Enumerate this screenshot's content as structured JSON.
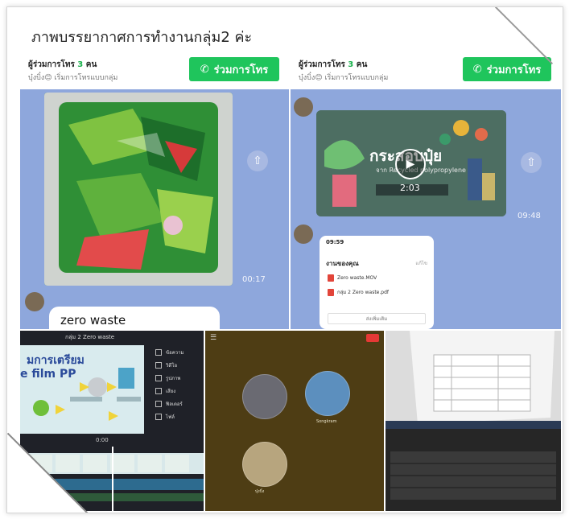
{
  "title": "ภาพบรรยากาศการทำงานกลุ่ม2 ค่ะ",
  "call_left": {
    "count_prefix": "ผู้ร่วมการโทร",
    "count_number": "3",
    "count_suffix": "คน",
    "subtitle": "บุ๋งบิ๋ง😊 เริ่มการโทรแบบกลุ่ม",
    "join_label": "ร่วมการโทร",
    "photo_time": "00:17",
    "message": "zero waste"
  },
  "call_right": {
    "count_prefix": "ผู้ร่วมการโทร",
    "count_number": "3",
    "count_suffix": "คน",
    "subtitle": "บุ๋งบิ๋ง😊 เริ่มการโทรแบบกลุ่ม",
    "join_label": "ร่วมการโทร",
    "video_title": "กระสอบปุ๋ย",
    "video_subtitle": "จาก Recycled polypropylene",
    "video_duration": "2:03",
    "video_time": "09:48",
    "phone": {
      "status_time": "09:59",
      "heading": "งานของคุณ",
      "heading_right": "แก้ไข",
      "files": [
        "Zero waste.MOV",
        "กลุ่ม 2 Zero waste.pdf"
      ],
      "button": "ส่งเพิ่มเติม"
    }
  },
  "editor": {
    "file_title": "กลุ่ม 2 Zero waste",
    "slide_line1": "มการเตรียม",
    "slide_line2": "e film PP",
    "menu": [
      "ข้อความ",
      "วิดีโอ",
      "รูปภาพ",
      "เสียง",
      "ฟิลเตอร์",
      "ไฟล์"
    ],
    "playhead": "0:00"
  },
  "video_call": {
    "participants": [
      "",
      "Songkram",
      "บุ๋งบิ๋ง"
    ]
  },
  "colors": {
    "line_green": "#1fc55c",
    "chat_blue": "#8ea7dc",
    "editor_bg": "#1f2128",
    "video_call_bg": "#4e3d14"
  },
  "icons": [
    "phone-icon",
    "share-icon",
    "play-icon",
    "pdf-file-icon",
    "menu-icon",
    "end-call-icon"
  ]
}
